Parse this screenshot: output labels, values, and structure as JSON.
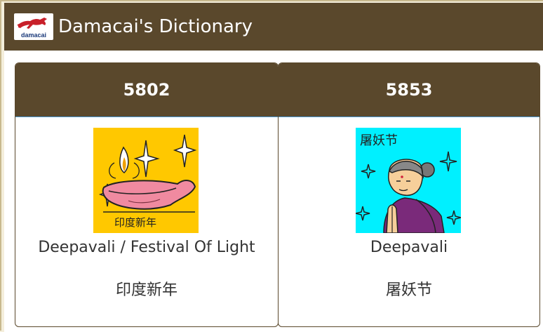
{
  "app": {
    "title": "Damacai's Dictionary",
    "logo_text": "damacai",
    "logo_icon": "red-horse-icon",
    "colors": {
      "header_bg": "#5a482c",
      "logo_red": "#c8202a",
      "logo_blue": "#1b3a7a"
    }
  },
  "cards": [
    {
      "number": "5802",
      "english": "Deepavali / Festival Of Light",
      "chinese": "印度新年",
      "image_icon": "oil-lamp-illustration",
      "image_caption": "印度新年",
      "image_bg": "#ffc800"
    },
    {
      "number": "5853",
      "english": "Deepavali",
      "chinese": "屠妖节",
      "image_icon": "praying-woman-illustration",
      "image_caption": "屠妖节",
      "image_bg": "#00f0ff"
    }
  ]
}
